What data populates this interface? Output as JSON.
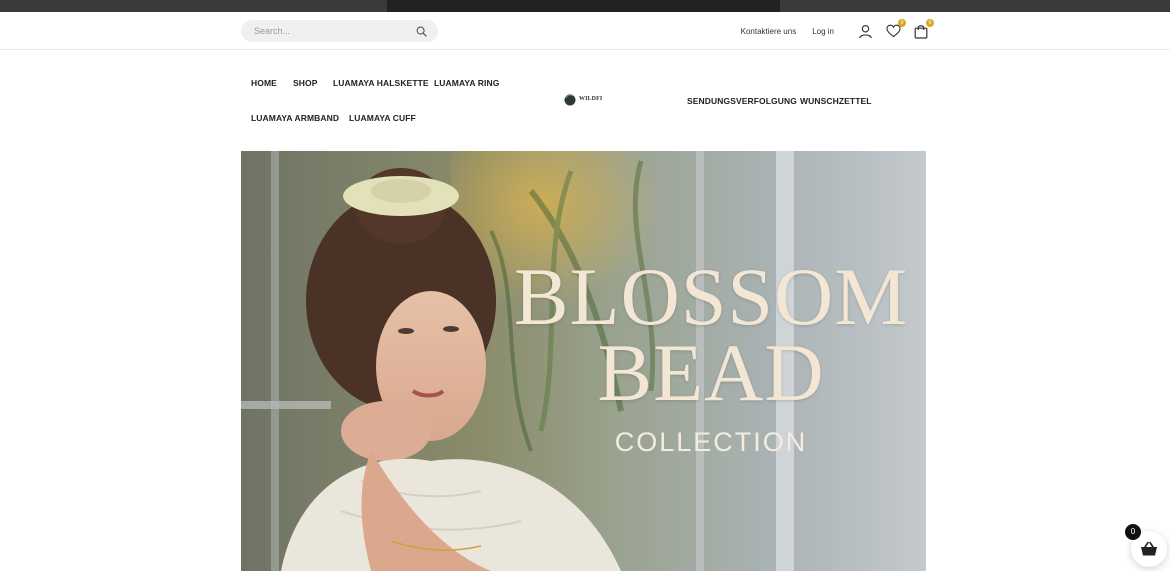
{
  "header": {
    "search_placeholder": "Search...",
    "contact_label": "Kontaktiere uns",
    "login_label": "Log in",
    "wishlist_count": "0",
    "cart_count": "0"
  },
  "nav": {
    "left_items": [
      "HOME",
      "SHOP",
      "LUAMAYA HALSKETTE",
      "LUAMAYA RING",
      "LUAMAYA ARMBAND",
      "LUAMAYA CUFF"
    ],
    "right_items": [
      "SENDUNGSVERFOLGUNG",
      "WUNSCHZETTEL"
    ],
    "logo_text": "wildfi"
  },
  "hero": {
    "title_line1": "BLOSSOM",
    "title_line2": "BEAD",
    "subtitle": "COLLECTION"
  },
  "floating_cart": {
    "count": "0"
  },
  "colors": {
    "badge": "#d9a81c",
    "hero_text": "#f3e6d4",
    "top_strip": "#3a3a3a"
  }
}
